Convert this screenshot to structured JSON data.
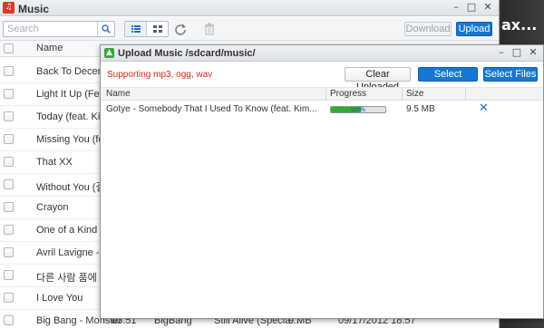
{
  "music_window": {
    "title": "Music",
    "app_icon": "music-note-icon",
    "controls": {
      "minimize": "–",
      "maximize": "□",
      "close": "✕"
    },
    "search": {
      "placeholder": "Search"
    },
    "download_label": "Download",
    "upload_label": "Upload",
    "header": {
      "name": "Name"
    },
    "rows": [
      {
        "title": "Back To December"
      },
      {
        "title": "Light It Up (Feat...."
      },
      {
        "title": "Today (feat. Kim ..."
      },
      {
        "title": "Missing You (feat..."
      },
      {
        "title": "That XX"
      },
      {
        "title": "Without You (결국)"
      },
      {
        "title": "Crayon"
      },
      {
        "title": "One of a Kind"
      },
      {
        "title": "Avril Lavigne - I L..."
      },
      {
        "title": "다른 사람 품에 안..."
      },
      {
        "title": "I Love You"
      },
      {
        "title": "Big Bang - Monster",
        "time": "03:51",
        "artist": "BigBang",
        "album": "Still Alive (Specia...",
        "size": "9 MB",
        "date": "09/17/2012 18:57"
      }
    ]
  },
  "side_strip": {
    "label": "ax..."
  },
  "upload_dialog": {
    "title": "Upload Music /sdcard/music/",
    "icon": "upload-arrow-icon",
    "supported": "Supporting mp3, ogg, wav",
    "clear_label": "Clear Uploaded",
    "select_folder_label": "Select Folder",
    "select_files_label": "Select Files",
    "columns": {
      "name": "Name",
      "progress": "Progress",
      "size": "Size"
    },
    "file": {
      "name": "Gotye - Somebody That I Used To Know (feat. Kim...",
      "progress_percent": 55,
      "progress_label": "55%",
      "size": "9.5 MB",
      "remove_icon": "close-icon"
    },
    "controls": {
      "minimize": "–",
      "maximize": "□",
      "close": "✕"
    }
  }
}
